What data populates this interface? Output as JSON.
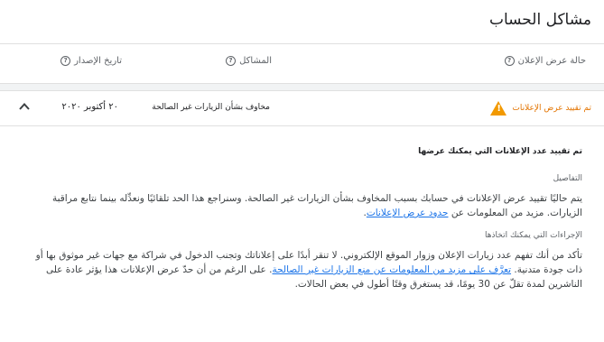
{
  "header": {
    "title": "مشاكل الحساب"
  },
  "columns": {
    "status": "حالة عرض الإعلان",
    "issues": "المشاكل",
    "date": "تاريخ الإصدار"
  },
  "row": {
    "status": "تم تقييد عرض الإعلانات",
    "issue": "مخاوف بشأن الزيارات غير الصالحة",
    "date": "٢٠ أكتوبر ٢٠٢٠"
  },
  "details": {
    "heading": "تم تقييد عدد الإعلانات التي يمكنك عرضها",
    "details_label": "التفاصيل",
    "details_text": "يتم حاليًا تقييد عرض الإعلانات في حسابك بسبب المخاوف بشأن الزيارات غير الصالحة. وسنراجع هذا الحد تلقائيًا ونعدِّله بينما نتابع مراقبة الزيارات. مزيد من المعلومات عن",
    "details_link": "حدود عرض الإعلانات",
    "details_end": ".",
    "actions_label": "الإجراءات التي يمكنك اتخاذها",
    "actions_text": "تأكد من أنك تفهم عدد زيارات الإعلان وزوار الموقع الإلكتروني. لا تنقر أبدًا على إعلاناتك وتجنب الدخول في شراكة مع جهات غير موثوق بها أو ذات جودة متدنية.",
    "actions_link": "تعرَّف على مزيد من المعلومات عن منع الزيارات غير الصالحة",
    "actions_end": ". على الرغم من أن حدّ عرض الإعلانات هذا يؤثر عادة على الناشرين لمدة تقلّ عن 30 يومًا، قد يستغرق وقتًا أطول في بعض الحالات."
  }
}
